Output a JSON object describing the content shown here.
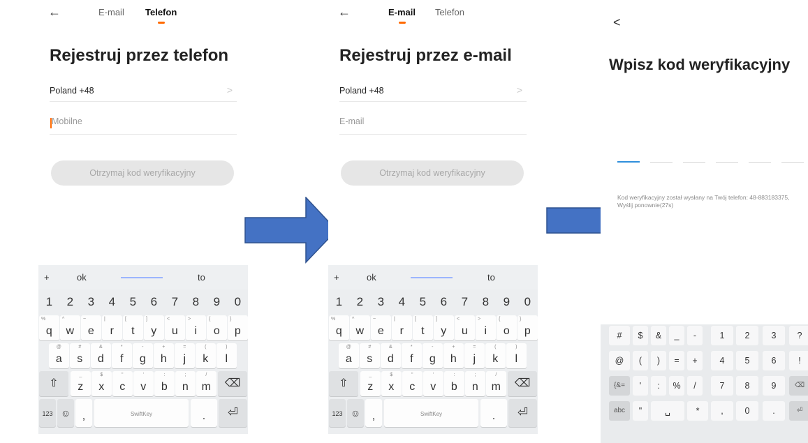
{
  "screen1": {
    "tabs": [
      "E-mail",
      "Telefon"
    ],
    "active_tab": "Telefon",
    "title": "Rejestruj przez telefon",
    "country": "Poland +48",
    "input_placeholder": "Mobilne",
    "button": "Otrzymaj kod weryfikacyjny"
  },
  "screen2": {
    "tabs": [
      "E-mail",
      "Telefon"
    ],
    "active_tab": "E-mail",
    "title": "Rejestruj przez e-mail",
    "country": "Poland +48",
    "input_placeholder": "E-mail",
    "button": "Otrzymaj kod weryfikacyjny"
  },
  "keyboard": {
    "suggestions": [
      "+",
      "ok",
      "to"
    ],
    "number_row": [
      "1",
      "2",
      "3",
      "4",
      "5",
      "6",
      "7",
      "8",
      "9",
      "0"
    ],
    "row1": [
      [
        "q",
        "%"
      ],
      [
        "w",
        "^"
      ],
      [
        "e",
        "~"
      ],
      [
        "r",
        "|"
      ],
      [
        "t",
        "["
      ],
      [
        "y",
        "]"
      ],
      [
        "u",
        "<"
      ],
      [
        "i",
        ">"
      ],
      [
        "o",
        "{"
      ],
      [
        "p",
        "}"
      ]
    ],
    "row2": [
      [
        "a",
        "@"
      ],
      [
        "s",
        "#"
      ],
      [
        "d",
        "&"
      ],
      [
        "f",
        "*"
      ],
      [
        "g",
        "-"
      ],
      [
        "h",
        "+"
      ],
      [
        "j",
        "="
      ],
      [
        "k",
        "("
      ],
      [
        "l",
        ")"
      ]
    ],
    "row3": [
      [
        "z",
        "_"
      ],
      [
        "x",
        "$"
      ],
      [
        "c",
        "\""
      ],
      [
        "v",
        "'"
      ],
      [
        "b",
        ":"
      ],
      [
        "n",
        ";"
      ],
      [
        "m",
        "/"
      ]
    ],
    "mode_key": "123",
    "emoji_key": "☺",
    "comma_key": ",",
    "space_label": "SwiftKey",
    "period_key": ".",
    "shift_icon": "⇧",
    "backspace_icon": "⌫",
    "enter_icon": "⏎"
  },
  "screen3": {
    "back": "<",
    "title": "Wpisz kod weryfikacyjny",
    "message": "Kod weryfikacyjny został wysłany na Twój telefon: 48-883183375, Wyślij ponownie(27s)",
    "keypad": [
      [
        "#",
        "$",
        "&",
        "_",
        "-",
        "1",
        "2",
        "3",
        "?"
      ],
      [
        "@",
        "(",
        ")",
        "=",
        "+",
        "4",
        "5",
        "6",
        "!"
      ],
      [
        "{&=",
        "'",
        ":",
        "%",
        "/",
        "7",
        "8",
        "9",
        "⌫"
      ],
      [
        "abc",
        "\"",
        "␣",
        "*",
        ",",
        "0",
        ".",
        "⏎"
      ]
    ]
  },
  "colors": {
    "accent": "#ff6a00",
    "arrow": "#4472c4",
    "code_active": "#2f8fdc"
  }
}
